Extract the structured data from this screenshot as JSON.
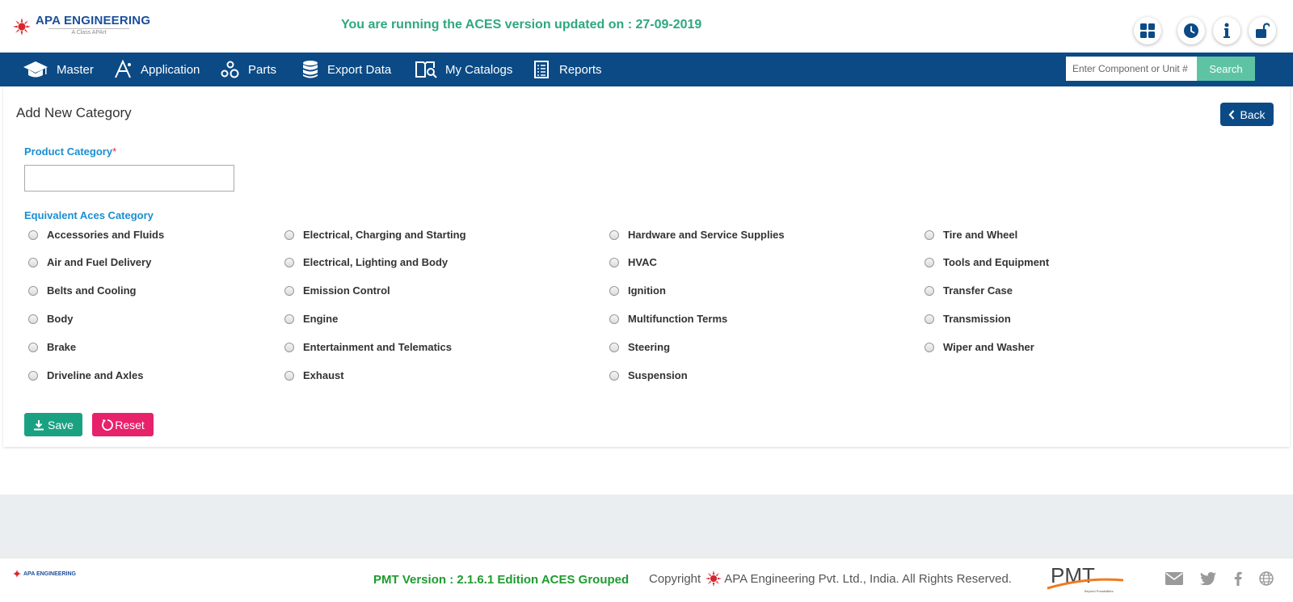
{
  "header": {
    "logo_name": "APA ENGINEERING",
    "logo_sub": "A Class APArt",
    "update_message": "You are running the ACES version updated on : 27-09-2019",
    "buttons": [
      "dashboard-grid-icon",
      "history-clock-icon",
      "info-icon",
      "unlock-icon"
    ]
  },
  "nav": {
    "items": [
      {
        "label": "Master",
        "icon": "graduation-cap-icon"
      },
      {
        "label": "Application",
        "icon": "application-icon"
      },
      {
        "label": "Parts",
        "icon": "parts-icon"
      },
      {
        "label": "Export Data",
        "icon": "database-icon"
      },
      {
        "label": "My Catalogs",
        "icon": "catalog-search-icon"
      },
      {
        "label": "Reports",
        "icon": "report-list-icon"
      }
    ],
    "search_placeholder": "Enter Component or Unit #",
    "search_label": "Search"
  },
  "form": {
    "title": "Add New Category",
    "back_label": "Back",
    "product_category_label": "Product Category",
    "required_mark": "*",
    "product_category_value": "",
    "equivalent_label": "Equivalent Aces Category",
    "columns": [
      [
        "Accessories and Fluids",
        "Air and Fuel Delivery",
        "Belts and Cooling",
        "Body",
        "Brake",
        "Driveline and Axles"
      ],
      [
        "Electrical, Charging and Starting",
        "Electrical, Lighting and Body",
        "Emission Control",
        "Engine",
        "Entertainment and Telematics",
        "Exhaust"
      ],
      [
        "Hardware and Service Supplies",
        "HVAC",
        "Ignition",
        "Multifunction Terms",
        "Steering",
        "Suspension"
      ],
      [
        "Tire and Wheel",
        "Tools and Equipment",
        "Transfer Case",
        "Transmission",
        "Wiper and Washer"
      ]
    ],
    "save_label": "Save",
    "reset_label": "Reset"
  },
  "footer": {
    "logo_name": "APA ENGINEERING",
    "pmt_version": "PMT Version : 2.1.6.1  Edition ACES Grouped",
    "copyright_prefix": "Copyright",
    "copyright_text": "APA Engineering Pvt. Ltd., India. All Rights Reserved.",
    "pmt_logo": "PMT",
    "pmt_tagline": "Beyond Possibilities",
    "social": [
      "mail-icon",
      "twitter-icon",
      "facebook-icon",
      "globe-icon"
    ]
  },
  "colors": {
    "navbar": "#0b4a85",
    "accent_green": "#2ea87e",
    "label_blue": "#1a8ed1",
    "save": "#1aa182",
    "reset": "#e8216b",
    "search_button": "#5ec3a3"
  }
}
